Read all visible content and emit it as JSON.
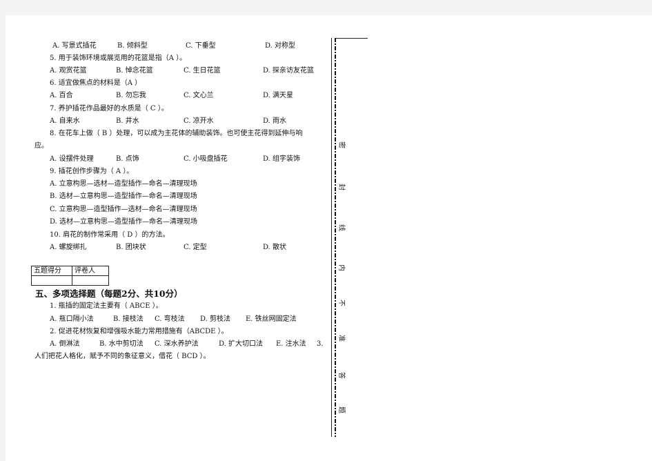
{
  "q4_options": [
    "A. 写景式插花",
    "B. 倾斜型",
    "C. 下垂型",
    "D. 对称型"
  ],
  "questions": [
    {
      "stem": "5. 用于装饰环境或展览用的花篮是指（A ）。",
      "options": [
        "A. 观赏花篮",
        "B. 悼念花篮",
        "C.  生日花篮",
        "D. 探亲访友花篮"
      ]
    },
    {
      "stem": "6. 适宜做焦点的材料是（A ）",
      "options": [
        "A. 百合",
        "B. 勿忘我",
        "C. 文心兰",
        "D. 满天星"
      ]
    },
    {
      "stem": "7. 养护插花作品最好的水质是（ C ）。",
      "options": [
        "A. 自来水",
        "B. 井水",
        "C. 凉开水",
        "D. 雨水"
      ]
    },
    {
      "stem": "8. 在花车上做（ B ）处理，可以成为主花体的辅助装饰。也可使主花得到延伸与响",
      "stem_cont": "应。",
      "options": [
        "A. 设摆件处理",
        "B. 点饰",
        "C. 小吸盘插花",
        "D. 组字装饰"
      ]
    },
    {
      "stem": "9. 插花创作步骤为（ A      ）。",
      "options": [
        "A. 立意构思—选材—造型插作—命名—清理现场",
        "B. 选材—立意构思—造型插作—命名—清理现场",
        "C. 立意构思—造型插作—选材—命名—清理现场",
        "D. 选材—立意构思—造型插作—命名—清理现场"
      ]
    },
    {
      "stem": "10. 肩花的制作常采用（  D  ）的方法。",
      "options": [
        "A. 螺旋绑扎",
        "B. 团块状",
        "C. 定型",
        "D. 散状"
      ]
    }
  ],
  "score_table": {
    "headers": [
      "五题得分",
      "评卷人"
    ],
    "values": [
      "",
      ""
    ]
  },
  "section5": {
    "title": "五、多项选择题（每题2分、共10分）",
    "q1": {
      "stem": "1. 瓶插的固定法主要有（  ABCE  ）。",
      "options": [
        "A. 瓶口隔小法",
        "B. 接枝法",
        "C. 弯枝法",
        "D. 剪枝法",
        "E. 铁丝网固定法"
      ]
    },
    "q2": {
      "stem": "2. 促进花材恢复和增强吸水能力常用措施有（ABCDE  ）。",
      "options": [
        "A. 倒淋法",
        "B.  水中剪切法",
        "C. 深水养护法",
        "D. 扩大切口法",
        "E. 注水法",
        "3."
      ]
    },
    "q3_stem": "人们把花人格化，赋予不同的象征意义，借花（ BCD ）。"
  },
  "seal_line": {
    "chars": [
      "密",
      "封",
      "线",
      "内",
      "不",
      "准",
      "答",
      "题"
    ]
  }
}
